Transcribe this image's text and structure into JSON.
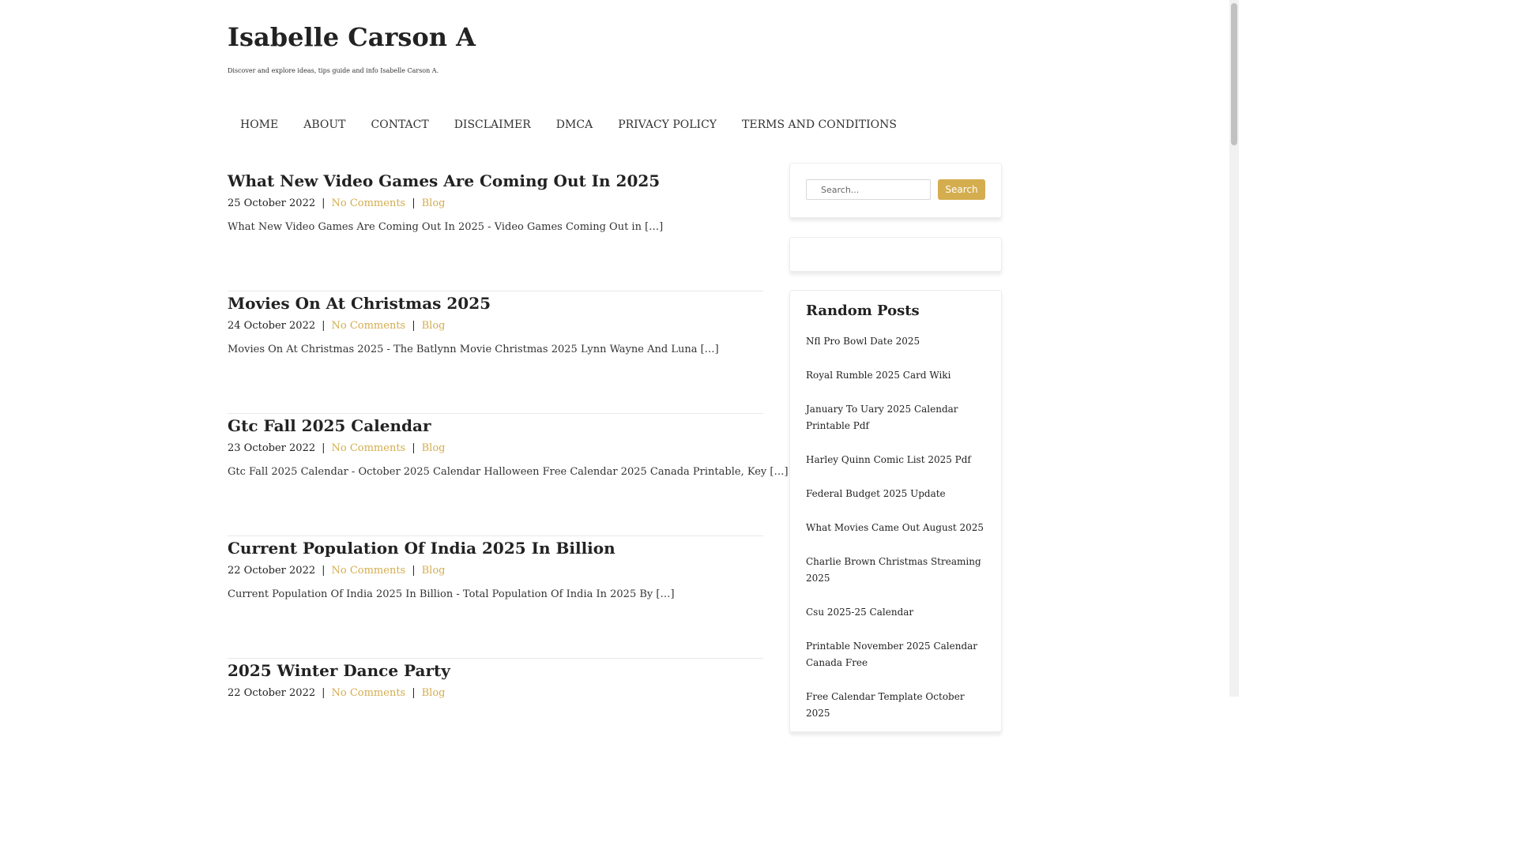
{
  "site": {
    "title": "Isabelle Carson A",
    "description": "Discover and explore ideas, tips guide and info Isabelle Carson A."
  },
  "nav": {
    "items": [
      "HOME",
      "ABOUT",
      "CONTACT",
      "DISCLAIMER",
      "DMCA",
      "PRIVACY POLICY",
      "TERMS AND CONDITIONS"
    ]
  },
  "posts": [
    {
      "title": "What New Video Games Are Coming Out In 2025",
      "date": "25 October 2022",
      "comments": "No Comments",
      "category": "Blog",
      "excerpt": "What New Video Games Are Coming Out In 2025 - Video Games Coming Out in […]"
    },
    {
      "title": "Movies On At Christmas 2025",
      "date": "24 October 2022",
      "comments": "No Comments",
      "category": "Blog",
      "excerpt": "Movies On At Christmas 2025 - The Batlynn Movie Christmas 2025 Lynn Wayne And Luna […]"
    },
    {
      "title": "Gtc Fall 2025 Calendar",
      "date": "23 October 2022",
      "comments": "No Comments",
      "category": "Blog",
      "excerpt": "Gtc Fall 2025 Calendar - October 2025 Calendar Halloween Free Calendar 2025 Canada Printable, Key […]"
    },
    {
      "title": "Current Population Of India 2025 In Billion",
      "date": "22 October 2022",
      "comments": "No Comments",
      "category": "Blog",
      "excerpt": "Current Population Of India 2025 In Billion - Total Population Of India In 2025 By […]"
    },
    {
      "title": "2025 Winter Dance Party",
      "date": "22 October 2022",
      "comments": "No Comments",
      "category": "Blog",
      "excerpt": ""
    }
  ],
  "search": {
    "placeholder": "Search...",
    "button_label": "Search"
  },
  "random_posts": {
    "title": "Random Posts",
    "items": [
      "Nfl Pro Bowl Date 2025",
      "Royal Rumble 2025 Card Wiki",
      "January To Uary 2025 Calendar Printable Pdf",
      "Harley Quinn Comic List 2025 Pdf",
      "Federal Budget 2025 Update",
      "What Movies Came Out August 2025",
      "Charlie Brown Christmas Streaming 2025",
      "Csu 2025-25 Calendar",
      "Printable November 2025 Calendar Canada Free",
      "Free Calendar Template October 2025"
    ]
  },
  "colors": {
    "accent": "#d4ad4e",
    "text": "#222222"
  }
}
